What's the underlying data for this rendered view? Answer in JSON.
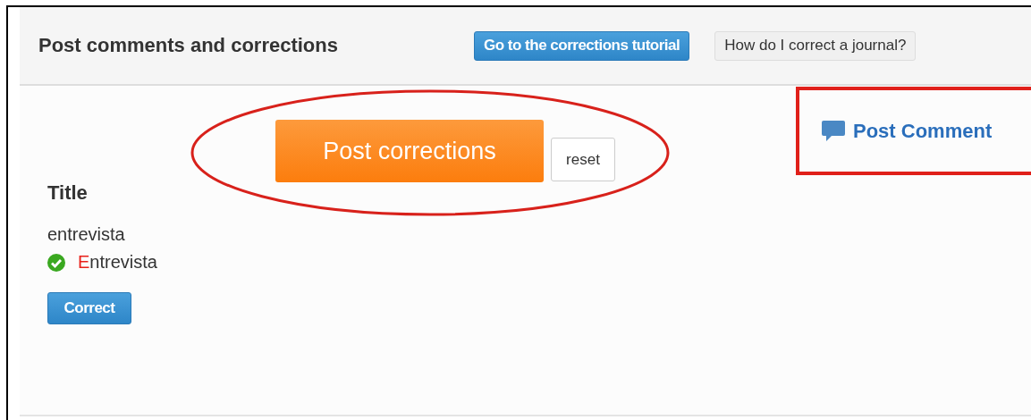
{
  "header": {
    "title": "Post comments and corrections",
    "buttons": [
      {
        "kind": "primary",
        "label": "Go to the corrections tutorial"
      },
      {
        "kind": "plain",
        "label": "How do I correct a journal?"
      }
    ]
  },
  "actions": {
    "post": "Post corrections",
    "reset": "reset"
  },
  "comment": {
    "label": "Post Comment"
  },
  "field": {
    "label": "Title",
    "original": "entrevista",
    "corrected": {
      "changed": "E",
      "unchanged": "ntrevista"
    },
    "accepted": true,
    "button": "Correct"
  }
}
